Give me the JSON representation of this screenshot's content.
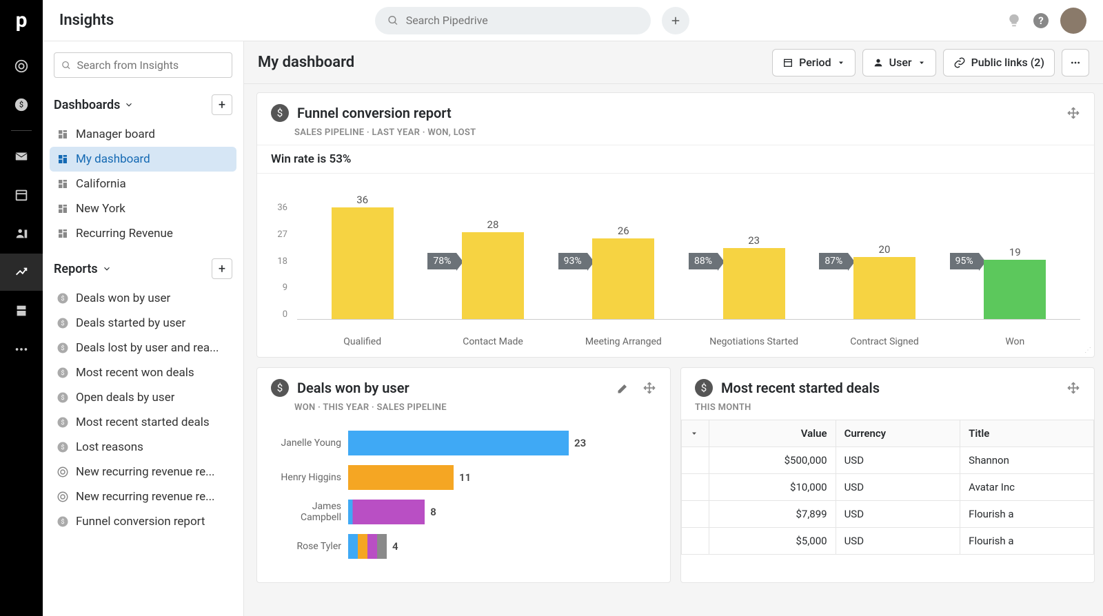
{
  "app": {
    "title": "Insights",
    "search_placeholder": "Search Pipedrive"
  },
  "sidebar": {
    "search_placeholder": "Search from Insights",
    "dashboards_label": "Dashboards",
    "reports_label": "Reports",
    "dashboards": [
      {
        "label": "Manager board"
      },
      {
        "label": "My dashboard"
      },
      {
        "label": "California"
      },
      {
        "label": "New York"
      },
      {
        "label": "Recurring Revenue"
      }
    ],
    "reports": [
      {
        "label": "Deals won by user"
      },
      {
        "label": "Deals started by user"
      },
      {
        "label": "Deals lost by user and rea..."
      },
      {
        "label": "Most recent won deals"
      },
      {
        "label": "Open deals by user"
      },
      {
        "label": "Most recent started deals"
      },
      {
        "label": "Lost reasons"
      },
      {
        "label": "New recurring revenue re..."
      },
      {
        "label": "New recurring revenue re..."
      },
      {
        "label": "Funnel conversion report"
      }
    ]
  },
  "toolbar": {
    "title": "My dashboard",
    "period_label": "Period",
    "user_label": "User",
    "public_links_label": "Public links (2)"
  },
  "funnel": {
    "title": "Funnel conversion report",
    "meta": "SALES PIPELINE   ·   LAST YEAR   ·   WON, LOST",
    "winrate": "Win rate is 53%"
  },
  "deals_won": {
    "title": "Deals won by user",
    "meta": "WON   ·   THIS YEAR   ·   SALES PIPELINE"
  },
  "recent": {
    "title": "Most recent started deals",
    "meta": "THIS MONTH",
    "columns": {
      "value": "Value",
      "currency": "Currency",
      "title": "Title"
    },
    "rows": [
      {
        "value": "$500,000",
        "currency": "USD",
        "title": "Shannon"
      },
      {
        "value": "$10,000",
        "currency": "USD",
        "title": "Avatar Inc"
      },
      {
        "value": "$7,899",
        "currency": "USD",
        "title": "Flourish a"
      },
      {
        "value": "$5,000",
        "currency": "USD",
        "title": "Flourish a"
      }
    ]
  },
  "chart_data": [
    {
      "type": "bar",
      "title": "Funnel conversion report",
      "ylabel": "",
      "xlabel": "",
      "ylim": [
        0,
        36
      ],
      "yticks": [
        0,
        9,
        18,
        27,
        36
      ],
      "categories": [
        "Qualified",
        "Contact Made",
        "Meeting Arranged",
        "Negotiations Started",
        "Contract Signed",
        "Won"
      ],
      "values": [
        36,
        28,
        26,
        23,
        20,
        19
      ],
      "conversions": [
        "78%",
        "93%",
        "88%",
        "87%",
        "95%"
      ],
      "colors": [
        "#f6d342",
        "#f6d342",
        "#f6d342",
        "#f6d342",
        "#f6d342",
        "#5cc85c"
      ]
    },
    {
      "type": "bar",
      "orientation": "horizontal",
      "title": "Deals won by user",
      "categories": [
        "Janelle Young",
        "Henry Higgins",
        "James Campbell",
        "Rose Tyler"
      ],
      "values": [
        23,
        11,
        8,
        4
      ],
      "colors": [
        "#3fa9f5",
        "#f5a623",
        "#b94fc4",
        "#mixed"
      ],
      "stacked_last": [
        {
          "w": 3,
          "c": "#3fa9f5"
        },
        {
          "w": 3,
          "c": "#f5a623"
        },
        {
          "w": 3,
          "c": "#b94fc4"
        },
        {
          "w": 3,
          "c": "#8a8a8a"
        }
      ]
    }
  ]
}
